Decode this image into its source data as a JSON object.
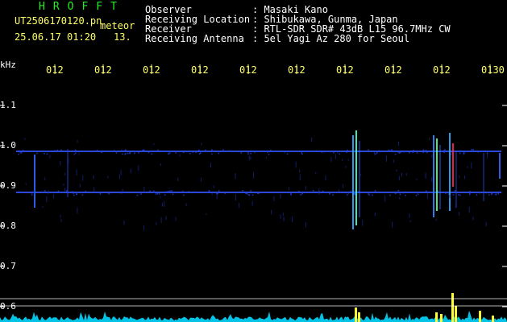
{
  "header": {
    "brand": "HROFFT",
    "filename": "UT2506170120.pn",
    "filename_suffix": "meteor",
    "datetime": "25.06.17 01:20",
    "count": "13.",
    "fields": [
      {
        "label": "Observer",
        "value": ": Masaki Kano"
      },
      {
        "label": "Receiving Location",
        "value": ": Shibukawa, Gunma, Japan"
      },
      {
        "label": "Receiver",
        "value": ": RTL-SDR SDR# 43dB L15 96.7MHz CW"
      },
      {
        "label": "Receiving Antenna",
        "value": ": 5el Yagi Az 280 for Seoul"
      }
    ]
  },
  "axis": {
    "unit": "kHz",
    "y_ticks": [
      "1.1",
      "1.0",
      "0.9",
      "0.8",
      "0.7",
      "0.6"
    ],
    "x_ticks": [
      "012",
      "012",
      "012",
      "012",
      "012",
      "012",
      "012",
      "012",
      "012",
      "0130"
    ]
  },
  "colors": {
    "background": "#000000",
    "text_white": "#ffffff",
    "text_yellow": "#ffff66",
    "brand_green": "#22ee22",
    "carrier": "#3355ff",
    "signal_hot": "#ff2255",
    "baseline": "#00d8ff"
  }
}
